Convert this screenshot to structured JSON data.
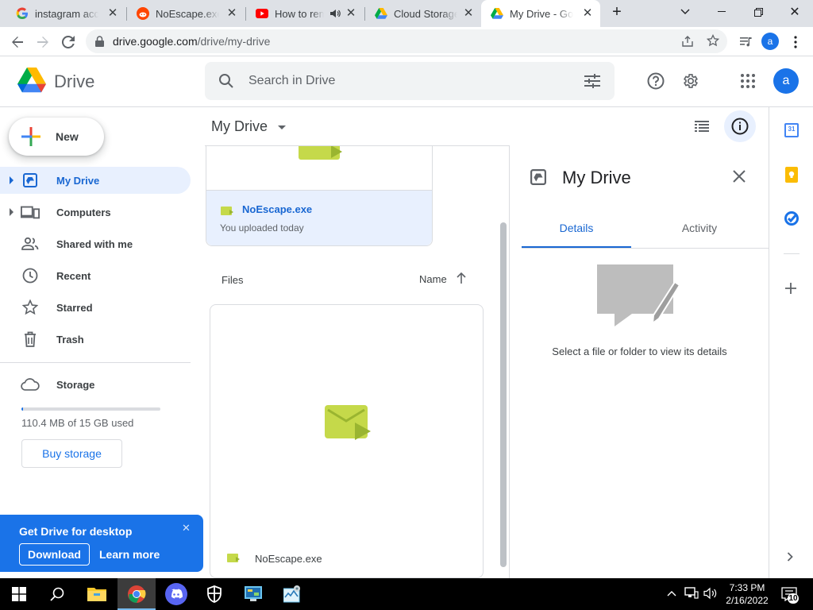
{
  "browser": {
    "tabs": [
      {
        "title": "instagram account",
        "favicon": "google-g",
        "active": false
      },
      {
        "title": "NoEscape.exe : ",
        "favicon": "reddit",
        "active": false
      },
      {
        "title": "How to remove",
        "favicon": "youtube",
        "active": false,
        "audio": true
      },
      {
        "title": "Cloud Storage for",
        "favicon": "google-drive",
        "active": false
      },
      {
        "title": "My Drive - Google",
        "favicon": "google-drive",
        "active": true
      }
    ],
    "url_host": "drive.google.com",
    "url_path": "/drive/my-drive",
    "profile_initial": "a"
  },
  "drive": {
    "app_name": "Drive",
    "search_placeholder": "Search in Drive",
    "user_initial": "a",
    "new_label": "New",
    "nav": [
      {
        "label": "My Drive",
        "icon": "my-drive-icon",
        "selected": true,
        "expandable": true
      },
      {
        "label": "Computers",
        "icon": "computers-icon",
        "selected": false,
        "expandable": true
      },
      {
        "label": "Shared with me",
        "icon": "shared-icon",
        "selected": false,
        "expandable": false
      },
      {
        "label": "Recent",
        "icon": "clock-icon",
        "selected": false,
        "expandable": false
      },
      {
        "label": "Starred",
        "icon": "star-icon",
        "selected": false,
        "expandable": false
      },
      {
        "label": "Trash",
        "icon": "trash-icon",
        "selected": false,
        "expandable": false
      }
    ],
    "storage": {
      "label": "Storage",
      "used_text": "110.4 MB of 15 GB used",
      "used_fraction": 0.007,
      "buy_label": "Buy storage"
    },
    "promo": {
      "title": "Get Drive for desktop",
      "download_label": "Download",
      "learn_more_label": "Learn more"
    },
    "main": {
      "title": "My Drive",
      "suggested": {
        "name": "NoEscape.exe",
        "subtitle": "You uploaded today"
      },
      "files_header": "Files",
      "sort_label": "Name",
      "file": {
        "name": "NoEscape.exe"
      }
    },
    "details": {
      "title": "My Drive",
      "tabs": [
        {
          "label": "Details",
          "active": true
        },
        {
          "label": "Activity",
          "active": false
        }
      ],
      "empty_text": "Select a file or folder to view its details"
    },
    "side_panel": {
      "calendar_day": "31"
    }
  },
  "taskbar": {
    "time": "7:33 PM",
    "date": "2/16/2022",
    "notifications": "10"
  },
  "colors": {
    "accent": "#1a73e8",
    "selected_bg": "#e8f0fe",
    "file_icon": "#c5d94a"
  }
}
